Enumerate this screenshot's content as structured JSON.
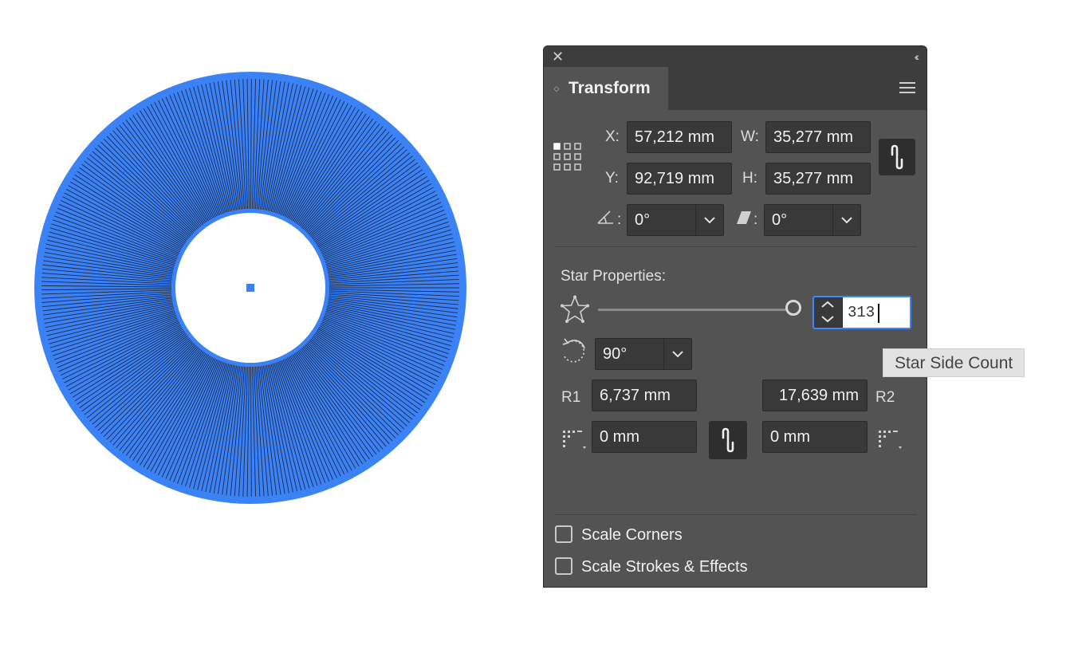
{
  "artwork": {
    "star_color": "#3b82f6",
    "center_color": "#ffffff",
    "spoke_color": "#1f2a44"
  },
  "panel": {
    "title": "Transform",
    "x": {
      "label": "X:",
      "value": "57,212 mm"
    },
    "y": {
      "label": "Y:",
      "value": "92,719 mm"
    },
    "w": {
      "label": "W:",
      "value": "35,277 mm"
    },
    "h": {
      "label": "H:",
      "value": "35,277 mm"
    },
    "rotate_angle": {
      "separator": ":",
      "value": "0°"
    },
    "shear_angle": {
      "separator": ":",
      "value": "0°"
    },
    "star_properties": {
      "title": "Star Properties:",
      "side_count": "313",
      "side_count_tooltip": "Star Side Count",
      "rotation": "90°",
      "r1": {
        "label": "R1",
        "value": "6,737 mm"
      },
      "r2": {
        "label": "R2",
        "value": "17,639 mm"
      },
      "corner_radius_left": "0 mm",
      "corner_radius_right": "0 mm"
    },
    "options": {
      "scale_corners": {
        "label": "Scale Corners",
        "checked": false
      },
      "scale_strokes": {
        "label": "Scale Strokes & Effects",
        "checked": false
      }
    },
    "icons": {
      "close": "close-icon",
      "collapse": "collapse-icon",
      "menu": "menu-icon",
      "reference_point": "reference-point-icon",
      "link": "chain-link-icon",
      "angle": "angle-icon",
      "shear": "shear-icon",
      "star": "star-icon",
      "rotate": "rotate-icon",
      "corner": "corner-radius-icon"
    },
    "accent_color": "#3b87ff"
  }
}
